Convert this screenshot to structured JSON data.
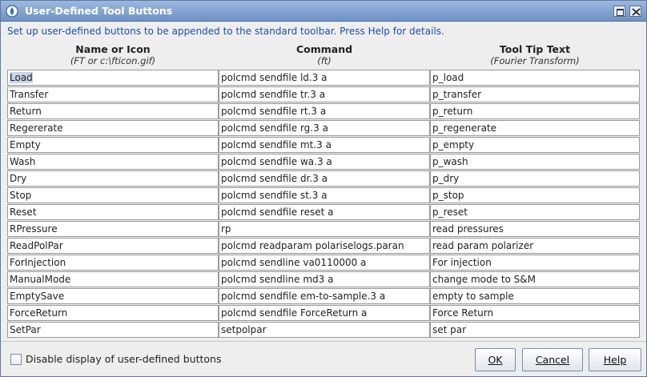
{
  "window": {
    "title": "User-Defined Tool Buttons"
  },
  "intro": "Set up user-defined buttons to be appended to the standard toolbar. Press Help for details.",
  "columns": [
    {
      "title": "Name or Icon",
      "hint": "(FT or c:\\fticon.gif)"
    },
    {
      "title": "Command",
      "hint": "(ft)"
    },
    {
      "title": "Tool Tip Text",
      "hint": "(Fourier Transform)"
    }
  ],
  "rows": [
    {
      "name": "Load",
      "command": "polcmd sendfile ld.3 a",
      "tooltip": "p_load"
    },
    {
      "name": "Transfer",
      "command": "polcmd sendfile tr.3 a",
      "tooltip": "p_transfer"
    },
    {
      "name": "Return",
      "command": "polcmd sendfile rt.3 a",
      "tooltip": "p_return"
    },
    {
      "name": "Regererate",
      "command": "polcmd sendfile rg.3 a",
      "tooltip": "p_regenerate"
    },
    {
      "name": "Empty",
      "command": "polcmd sendfile mt.3 a",
      "tooltip": "p_empty"
    },
    {
      "name": "Wash",
      "command": "polcmd sendfile wa.3 a",
      "tooltip": "p_wash"
    },
    {
      "name": "Dry",
      "command": "polcmd sendfile dr.3 a",
      "tooltip": "p_dry"
    },
    {
      "name": "Stop",
      "command": "polcmd sendfile st.3 a",
      "tooltip": "p_stop"
    },
    {
      "name": "Reset",
      "command": "polcmd sendfile reset a",
      "tooltip": "p_reset"
    },
    {
      "name": "RPressure",
      "command": "rp",
      "tooltip": "read pressures"
    },
    {
      "name": "ReadPolPar",
      "command": "polcmd readparam polariselogs.paran",
      "tooltip": "read param polarizer"
    },
    {
      "name": "ForInjection",
      "command": "polcmd sendline va0110000 a",
      "tooltip": "For injection"
    },
    {
      "name": "ManualMode",
      "command": "polcmd sendline md3 a",
      "tooltip": "change mode to S&M"
    },
    {
      "name": "EmptySave",
      "command": "polcmd sendfile em-to-sample.3 a",
      "tooltip": "empty to sample"
    },
    {
      "name": "ForceReturn",
      "command": "polcmd sendfile ForceReturn a",
      "tooltip": "Force Return"
    },
    {
      "name": "SetPar",
      "command": "setpolpar",
      "tooltip": "set par"
    }
  ],
  "footer": {
    "checkbox_label": "Disable display of user-defined buttons",
    "checkbox_checked": false,
    "ok_label": "OK",
    "cancel_label": "Cancel",
    "help_label": "Help"
  },
  "icons": {
    "app": "app-icon",
    "maximize": "maximize-icon",
    "close": "close-icon"
  },
  "colors": {
    "titlebar": "#7e9fd0",
    "intro_text": "#1a4fb0",
    "selection": "#c8d4e6"
  }
}
